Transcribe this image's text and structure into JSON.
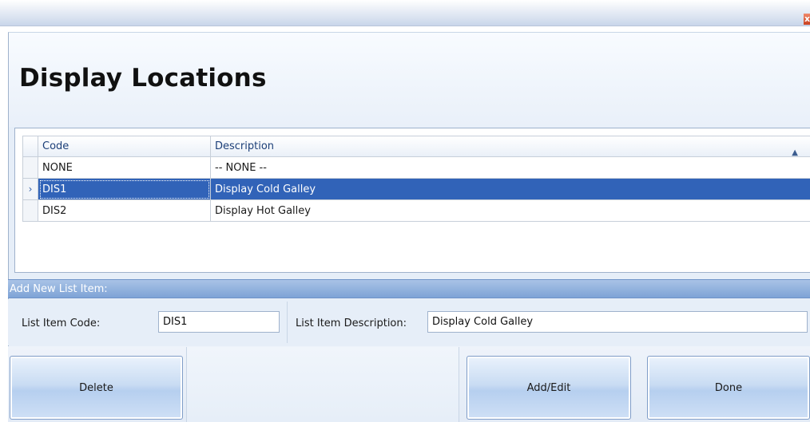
{
  "window": {
    "close_glyph": "x"
  },
  "page_title": "Display Locations",
  "grid": {
    "columns": {
      "code": "Code",
      "description": "Description"
    },
    "sort_indicator": "▲",
    "selected_indicator": "›",
    "rows": [
      {
        "code": "NONE",
        "description": "-- NONE --",
        "selected": false
      },
      {
        "code": "DIS1",
        "description": "Display Cold Galley",
        "selected": true
      },
      {
        "code": "DIS2",
        "description": "Display Hot Galley",
        "selected": false
      }
    ]
  },
  "add_section": {
    "title": "Add New List Item:",
    "code_label": "List Item Code:",
    "code_value": "DIS1",
    "description_label": "List Item Description:",
    "description_value": "Display Cold Galley"
  },
  "buttons": {
    "delete": "Delete",
    "add_edit": "Add/Edit",
    "done": "Done"
  },
  "colors": {
    "selection": "#3163b8",
    "section_bar": "#7ea3d6",
    "panel_bg": "#e6eef8"
  }
}
